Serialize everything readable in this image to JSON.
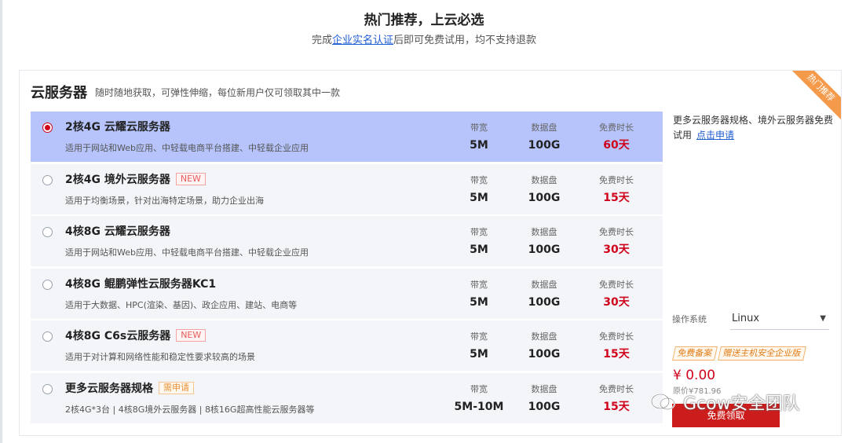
{
  "header": {
    "title": "热门推荐，上云必选",
    "subtitle_before": "完成",
    "subtitle_link": "企业实名认证",
    "subtitle_after": "后即可免费试用，均不支持退款"
  },
  "card": {
    "ribbon": "热门推荐",
    "title": "云服务器",
    "desc": "随时随地获取，可弹性伸缩，每位新用户仅可领取其中一款"
  },
  "spec_labels": {
    "bandwidth": "带宽",
    "disk": "数据盘",
    "duration": "免费时长"
  },
  "options": [
    {
      "name": "2核4G 云耀云服务器",
      "tag": "",
      "desc": "适用于网站和Web应用、中轻载电商平台搭建、中轻载企业应用",
      "bandwidth": "5M",
      "disk": "100G",
      "duration": "60天",
      "selected": true
    },
    {
      "name": "2核4G 境外云服务器",
      "tag": "NEW",
      "desc": "适用于均衡场景，针对出海特定场景，助力企业出海",
      "bandwidth": "5M",
      "disk": "100G",
      "duration": "15天",
      "selected": false
    },
    {
      "name": "4核8G 云耀云服务器",
      "tag": "",
      "desc": "适用于网站和Web应用、中轻载电商平台搭建、中轻载企业应用",
      "bandwidth": "5M",
      "disk": "100G",
      "duration": "30天",
      "selected": false
    },
    {
      "name": "4核8G 鲲鹏弹性云服务器KC1",
      "tag": "",
      "desc": "适用于大数据、HPC(渲染、基因)、政企应用、建站、电商等",
      "bandwidth": "5M",
      "disk": "100G",
      "duration": "30天",
      "selected": false
    },
    {
      "name": "4核8G C6s云服务器",
      "tag": "NEW",
      "desc": "适用于对计算和网络性能和稳定性要求较高的场景",
      "bandwidth": "5M",
      "disk": "100G",
      "duration": "15天",
      "selected": false
    },
    {
      "name": "更多云服务器规格",
      "tag": "需申请",
      "desc": "2核4G*3台 | 4核8G境外云服务器 | 8核16G超高性能云服务器等",
      "bandwidth": "5M-10M",
      "disk": "100G",
      "duration": "15天",
      "selected": false
    }
  ],
  "side": {
    "more_text": "更多云服务器规格、境外云服务器免费试用",
    "more_link": "点击申请",
    "os_label": "操作系统",
    "os_value": "Linux",
    "badges": [
      "免费备案",
      "赠送主机安全企业版"
    ],
    "price": "¥ 0.00",
    "original_price": "原价¥781.96",
    "claim_button": "免费领取"
  },
  "watermark": {
    "text": "Gcow安全团队"
  },
  "colors": {
    "selected_row": "#b6c4fb",
    "row": "#f3f5f9",
    "accent_red": "#d0021b",
    "link_blue": "#1f5bd1",
    "ribbon_orange": "#f59a4a"
  }
}
